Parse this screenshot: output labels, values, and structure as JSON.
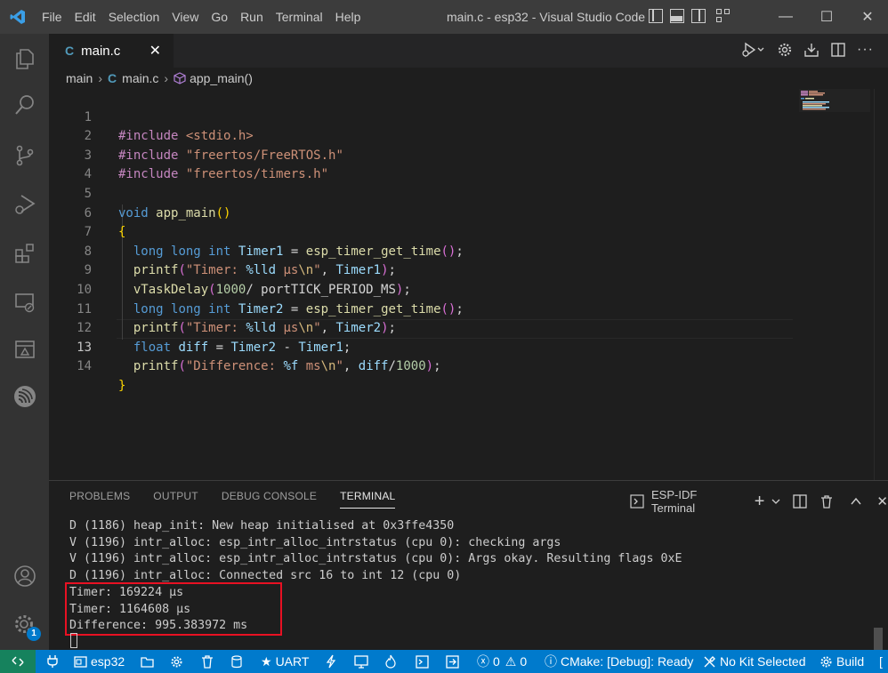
{
  "window": {
    "title": "main.c - esp32 - Visual Studio Code",
    "menu": [
      "File",
      "Edit",
      "Selection",
      "View",
      "Go",
      "Run",
      "Terminal",
      "Help"
    ]
  },
  "tab": {
    "label": "main.c",
    "icon": "C",
    "close": "✕"
  },
  "breadcrumb": {
    "folder": "main",
    "file": "main.c",
    "symbol": "app_main()",
    "file_icon": "C"
  },
  "editor": {
    "active_line": 13,
    "lines": [
      {
        "num": "1"
      },
      {
        "num": "2"
      },
      {
        "num": "3"
      },
      {
        "num": "4"
      },
      {
        "num": "5"
      },
      {
        "num": "6"
      },
      {
        "num": "7"
      },
      {
        "num": "8"
      },
      {
        "num": "9"
      },
      {
        "num": "10"
      },
      {
        "num": "11"
      },
      {
        "num": "12"
      },
      {
        "num": "13"
      },
      {
        "num": "14"
      }
    ],
    "code": {
      "include_kw": "#include",
      "inc1": "<stdio.h>",
      "inc2": "\"freertos/FreeRTOS.h\"",
      "inc3": "\"freertos/timers.h\"",
      "void_kw": "void",
      "main_fn": "app_main",
      "long_kw": "long",
      "int_kw": "int",
      "float_kw": "float",
      "timer1": "Timer1",
      "timer2": "Timer2",
      "diff": "diff",
      "get_time": "esp_timer_get_time",
      "printf": "printf",
      "delay": "vTaskDelay",
      "delay_arg": "1000",
      "tick": "portTICK_PERIOD_MS",
      "fmt_timer_a": "\"Timer: ",
      "fmt_timer_b": "%lld",
      "fmt_timer_c": " µs",
      "fmt_nl": "\\n",
      "fmt_q": "\"",
      "fmt_diff_a": "\"Difference: ",
      "fmt_diff_b": "%f",
      "fmt_diff_c": " ms",
      "div": "1000",
      "open_brace": "{",
      "close_brace": "}"
    }
  },
  "panel": {
    "tabs": [
      "PROBLEMS",
      "OUTPUT",
      "DEBUG CONSOLE",
      "TERMINAL"
    ],
    "active_tab": "TERMINAL",
    "terminal_name": "ESP-IDF Terminal",
    "terminal_lines": [
      "D (1186) heap_init: New heap initialised at 0x3ffe4350",
      "V (1196) intr_alloc: esp_intr_alloc_intrstatus (cpu 0): checking args",
      "V (1196) intr_alloc: esp_intr_alloc_intrstatus (cpu 0): Args okay. Resulting flags 0xE",
      "D (1196) intr_alloc: Connected src 16 to int 12 (cpu 0)",
      "Timer: 169224 µs",
      "Timer: 1164608 µs",
      "Difference: 995.383972 ms"
    ]
  },
  "statusbar": {
    "project": "esp32",
    "uart": "UART",
    "errors": "0",
    "warnings": "0",
    "cmake": "CMake: [Debug]: Ready",
    "kit": "No Kit Selected",
    "build": "Build"
  },
  "accounts_badge": "1",
  "colors": {
    "accent": "#007acc",
    "remote": "#16825d",
    "highlight_box": "#e81123"
  }
}
